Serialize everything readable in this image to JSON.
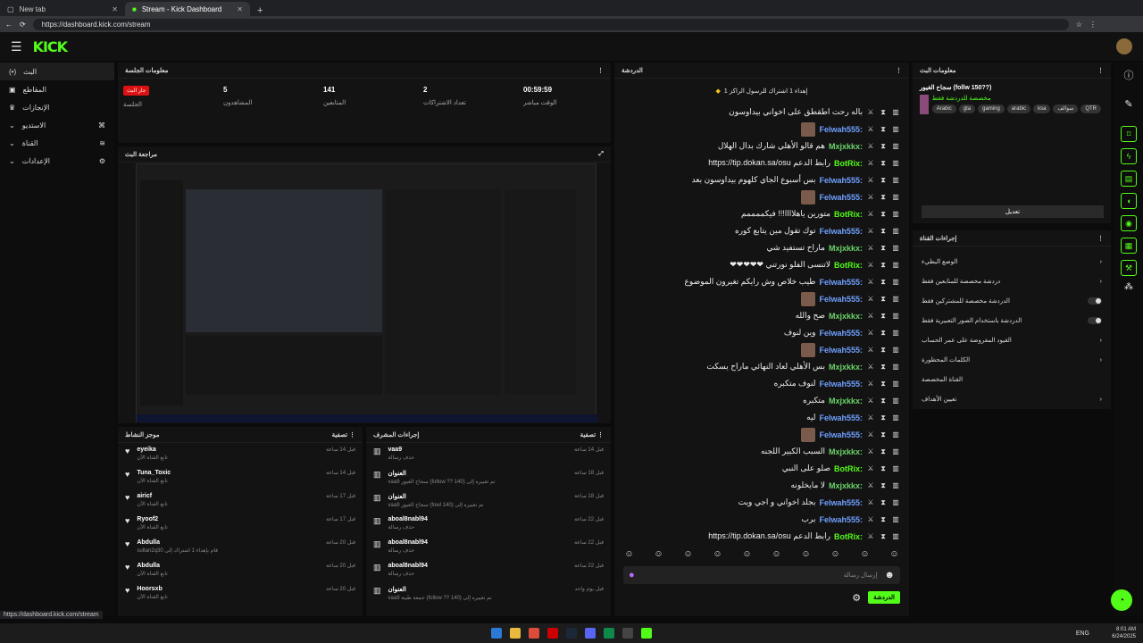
{
  "browser": {
    "tabs": [
      {
        "label": "New tab"
      },
      {
        "label": "Stream - Kick Dashboard"
      }
    ],
    "url": "https://dashboard.kick.com/stream",
    "status_url": "https://dashboard.kick.com/stream"
  },
  "app": {
    "logo": "KICK"
  },
  "sidebar": {
    "items": [
      {
        "label": "البث"
      },
      {
        "label": "المقاطع"
      },
      {
        "label": "الإنجازات"
      },
      {
        "label": "الاستديو"
      },
      {
        "label": "القناة"
      },
      {
        "label": "الإعدادات"
      }
    ]
  },
  "session": {
    "title": "معلومات الجلسة",
    "live_badge": "جار البث",
    "stats": [
      {
        "label": "الجلسة",
        "value": ""
      },
      {
        "label": "المشاهدون",
        "value": "5"
      },
      {
        "label": "المتابعين",
        "value": "141"
      },
      {
        "label": "تعداد الاشتراكات",
        "value": "2"
      },
      {
        "label": "الوقت مباشر",
        "value": "00:59:59"
      }
    ]
  },
  "preview": {
    "title": "مراجعة البث"
  },
  "activity": {
    "title": "موجز النشاط",
    "filter": "تصفية",
    "rows": [
      {
        "name": "eyeika",
        "sub": "تابع القناة الآن",
        "time": "قبل 14 ساعة"
      },
      {
        "name": "Tuna_Toxic",
        "sub": "تابع القناة الآن",
        "time": "قبل 14 ساعة"
      },
      {
        "name": "airicf",
        "sub": "تابع القناة الآن",
        "time": "قبل 17 ساعة"
      },
      {
        "name": "Ryoof2",
        "sub": "تابع القناة الآن",
        "time": "قبل 17 ساعة"
      },
      {
        "name": "Abdulla",
        "sub": "sultan2q30 قام بإهداء 1 اشتراك إلى",
        "time": "قبل 20 ساعة"
      },
      {
        "name": "Abdulla",
        "sub": "تابع القناة الآن",
        "time": "قبل 20 ساعة"
      },
      {
        "name": "Hoorsxb",
        "sub": "تابع القناة الآن",
        "time": "قبل 20 ساعة"
      }
    ]
  },
  "mod": {
    "title": "إجراءات المشرف",
    "filter": "تصفية",
    "rows": [
      {
        "name": "vaa9",
        "sub": "حذف رسالة",
        "time": "قبل 14 ساعة"
      },
      {
        "name": "العنوان",
        "sub": "vaa9 سجاح الغيور (follow ?? 140) تم تغييره إلى",
        "time": "قبل 18 ساعة"
      },
      {
        "name": "العنوان",
        "sub": "vaa9 سجاح الغيور (fowl 140) تم تغييره إلى",
        "time": "قبل 18 ساعة"
      },
      {
        "name": "aboal8nabl94",
        "sub": "حذف رسالة",
        "time": "قبل 22 ساعة"
      },
      {
        "name": "aboal8nabl94",
        "sub": "حذف رسالة",
        "time": "قبل 22 ساعة"
      },
      {
        "name": "aboal8nabl94",
        "sub": "حذف رسالة",
        "time": "قبل 22 ساعة"
      },
      {
        "name": "العنوان",
        "sub": "vaa9 جمعة طيبة (follow ?? 140) تم تغييره إلى",
        "time": "قبل يوم واحد"
      }
    ]
  },
  "chat": {
    "title": "الدردشة",
    "pinned": "إهداء 1 اشتراك للرسول الراكز 1",
    "input_placeholder": "إرسال رسالة",
    "send_label": "الدردشة",
    "lines": [
      {
        "user": "",
        "msg": "باله رحت اطقطق على اخواني بيداوسون",
        "color": "#6fa0ff",
        "emote": false
      },
      {
        "user": "Felwah555:",
        "msg": "",
        "color": "#6fa0ff",
        "emote": true
      },
      {
        "user": "Mxjxkkx:",
        "msg": "هم قالو الأهلي شارك بدال الهلال",
        "color": "#6ad46a",
        "emote": false
      },
      {
        "user": "BotRix:",
        "msg": "رابط الدعم https://tip.dokan.sa/osu",
        "color": "#53fc18",
        "emote": false
      },
      {
        "user": "Felwah555:",
        "msg": "بس أسبوع الجاي كلهوم بيداوسون بعد",
        "color": "#6fa0ff",
        "emote": false
      },
      {
        "user": "Felwah555:",
        "msg": "",
        "color": "#6fa0ff",
        "emote": true
      },
      {
        "user": "BotRix:",
        "msg": "متورين ياهلاااا!!! فيكممممم",
        "color": "#53fc18",
        "emote": false
      },
      {
        "user": "Felwah555:",
        "msg": "توك تقول مين يتابع كوره",
        "color": "#6fa0ff",
        "emote": false
      },
      {
        "user": "Mxjxkkx:",
        "msg": "ماراح تستفيد شي",
        "color": "#6ad46a",
        "emote": false
      },
      {
        "user": "BotRix:",
        "msg": "لاتنسى الفلو نورتني ❤❤❤❤❤",
        "color": "#53fc18",
        "emote": false
      },
      {
        "user": "Felwah555:",
        "msg": "طيب خلاص وش رايكم تغيرون الموضوع",
        "color": "#6fa0ff",
        "emote": false
      },
      {
        "user": "Felwah555:",
        "msg": "",
        "color": "#6fa0ff",
        "emote": true
      },
      {
        "user": "Mxjxkkx:",
        "msg": "صح والله",
        "color": "#6ad46a",
        "emote": false
      },
      {
        "user": "Felwah555:",
        "msg": "وين لنوف",
        "color": "#6fa0ff",
        "emote": false
      },
      {
        "user": "Felwah555:",
        "msg": "",
        "color": "#6fa0ff",
        "emote": true
      },
      {
        "user": "Mxjxkkx:",
        "msg": "بس الأهلي لعاد النهائي ماراح يسكت",
        "color": "#6ad46a",
        "emote": false
      },
      {
        "user": "Felwah555:",
        "msg": "لنوف متكبره",
        "color": "#6fa0ff",
        "emote": false
      },
      {
        "user": "Mxjxkkx:",
        "msg": "متكبره",
        "color": "#6ad46a",
        "emote": false
      },
      {
        "user": "Felwah555:",
        "msg": "ليه",
        "color": "#6fa0ff",
        "emote": false
      },
      {
        "user": "Felwah555:",
        "msg": "",
        "color": "#6fa0ff",
        "emote": true
      },
      {
        "user": "Mxjxkkx:",
        "msg": "السبب الكبير اللجنه",
        "color": "#6ad46a",
        "emote": false
      },
      {
        "user": "BotRix:",
        "msg": "صلو على النبي",
        "color": "#53fc18",
        "emote": false
      },
      {
        "user": "Mxjxkkx:",
        "msg": "لا مايخلونه",
        "color": "#6ad46a",
        "emote": false
      },
      {
        "user": "Felwah555:",
        "msg": "بجلد اخواني و اجي ويت",
        "color": "#6fa0ff",
        "emote": false
      },
      {
        "user": "Felwah555:",
        "msg": "برب",
        "color": "#6fa0ff",
        "emote": false
      },
      {
        "user": "BotRix:",
        "msg": "رابط الدعم https://tip.dokan.sa/osu",
        "color": "#53fc18",
        "emote": false
      }
    ]
  },
  "stream_info": {
    "title": "معلومات البث",
    "stream_title": "سجاح الغيور (follw 150??)",
    "category": "مخصصة للدردشة فقط",
    "tags": [
      "Arabic",
      "gta",
      "gaming",
      "arabic",
      "ksa",
      "سوالف",
      "QTR"
    ],
    "edit_button": "تعديل"
  },
  "channel_actions": {
    "title": "إجراءات القناة",
    "rows": [
      {
        "label": "الوضع البطيء",
        "control": "chevron"
      },
      {
        "label": "دردشة مخصصة للمتابعين فقط",
        "control": "chevron"
      },
      {
        "label": "الدردشة مخصصة للمشتركين فقط",
        "control": "toggle"
      },
      {
        "label": "الدردشة باستخدام الصور التعبيرية فقط",
        "control": "toggle"
      },
      {
        "label": "القيود المفروضة على عمر الحساب",
        "control": "chevron"
      },
      {
        "label": "الكلمات المحظورة",
        "control": "chevron"
      },
      {
        "label": "القناة المخصصة",
        "control": "none"
      },
      {
        "label": "تعيين الأهداف",
        "control": "chevron"
      }
    ]
  },
  "taskbar": {
    "lang": "ENG",
    "time": "8:01 AM",
    "date": "6/24/2025"
  },
  "colors": {
    "accent": "#53fc18",
    "live": "#dd1111"
  }
}
